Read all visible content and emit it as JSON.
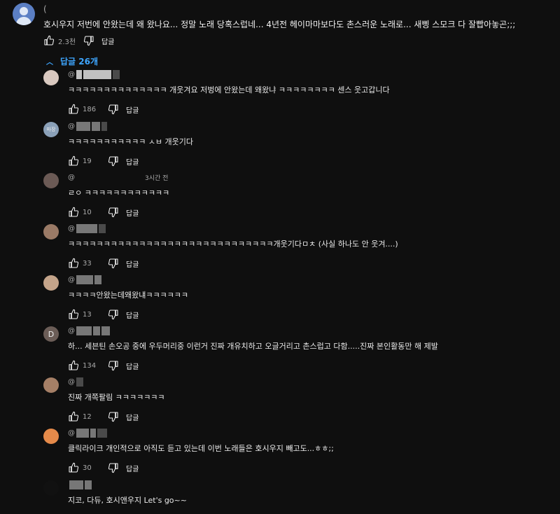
{
  "top_comment": {
    "author": "(",
    "text": "호시우지 저번에 안왔는데 왜 왔나요... 정말 노래 당혹스럽네... 4년전 헤이마마보다도 촌스러운 노래로... 새삥 스모크 다 잘빱아놓곤;;;",
    "likes": "2.3천",
    "reply_label": "답글"
  },
  "replies_toggle": {
    "label": "답글 26개"
  },
  "replies": [
    {
      "author": "@",
      "avatar_color": "#d9c9c0",
      "text": "ㅋㅋㅋㅋㅋㅋㅋㅋㅋㅋㅋㅋㅋㅋ 개웃겨요 저벙에 안왔는데 왜왔냐 ㅋㅋㅋㅋㅋㅋㅋㅋ 센스 웃고갑니다",
      "likes": "186",
      "reply_label": "답글"
    },
    {
      "author": "@",
      "avatar_color": "#8aa0b8",
      "avatar_text": "마장",
      "text": "ㅋㅋㅋㅋㅋㅋㅋㅋㅋㅋㅋ ㅅㅂ 개웃기다",
      "likes": "19",
      "reply_label": "답글"
    },
    {
      "author": "@",
      "avatar_color": "#6b5a55",
      "time": "3시간 전",
      "text": "ㄹㅇ ㅋㅋㅋㅋㅋㅋㅋㅋㅋㅋㅋㅋ",
      "likes": "10",
      "reply_label": "답글"
    },
    {
      "author": "@",
      "avatar_color": "#9a7a66",
      "text": "ㅋㅋㅋㅋㅋㅋㅋㅋㅋㅋㅋㅋㅋㅋㅋㅋㅋㅋㅋㅋㅋㅋㅋㅋㅋㅋㅋㅋㅋ개웃기다ㅁㅊ (사실 하나도 안 웃겨....)",
      "likes": "33",
      "reply_label": "답글"
    },
    {
      "author": "@",
      "avatar_color": "#c4a48a",
      "text": "ㅋㅋㅋㅋ안왔는데왜왔냬ㅋㅋㅋㅋㅋㅋ",
      "likes": "13",
      "reply_label": "답글"
    },
    {
      "author": "@",
      "avatar_color": "#6b5d57",
      "avatar_text": "D",
      "text": "하... 세븐틴 손오공 중에 우두머리중 이런거 진짜 개유치하고 오글거리고 촌스럽고 다함.....진짜 본인활동만 해 제발",
      "likes": "134",
      "reply_label": "답글"
    },
    {
      "author": "@",
      "avatar_color": "#a57f66",
      "text": "진짜 개쪽팔림 ㅋㅋㅋㅋㅋㅋㅋ",
      "likes": "12",
      "reply_label": "답글"
    },
    {
      "author": "@",
      "avatar_color": "#e58a4a",
      "text": "클릭라이크 개인적으로 아직도 듣고 있는데 이번 노래들은 호시우지 빼고도...ㅎㅎ;;",
      "likes": "30",
      "reply_label": "답글"
    },
    {
      "author": "",
      "avatar_color": "#111111",
      "text": "지코, 다듀, 호시앤우지 Let's go~~",
      "likes": "",
      "reply_label": ""
    }
  ]
}
